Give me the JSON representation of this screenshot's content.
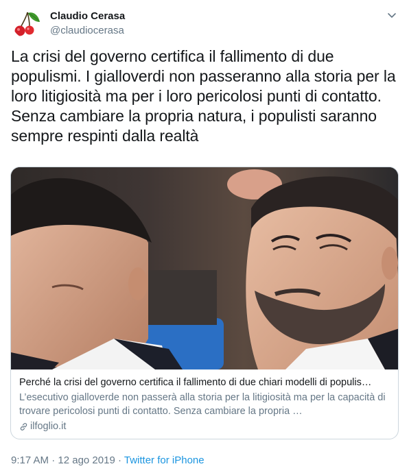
{
  "author": {
    "display_name": "Claudio Cerasa",
    "handle": "@claudiocerasa",
    "avatar_icon": "cherry-icon"
  },
  "tweet": {
    "text": "La crisi del governo certifica il fallimento di due populismi. I gialloverdi non passeranno alla storia per la loro litigiosità ma per i loro pericolosi punti di contatto. Senza cambiare la propria natura, i populisti saranno sempre respinti dalla realtà"
  },
  "card": {
    "title": "Perché la crisi del governo certifica il fallimento di due chiari modelli di populis…",
    "description": "L’esecutivo gialloverde non passerà alla storia per la litigiosità ma per la capacità di trovare pericolosi punti di contatto. Senza cambiare la propria …",
    "domain": "ilfoglio.it"
  },
  "meta": {
    "time": "9:17 AM",
    "separator1": " · ",
    "date": "12 ago 2019",
    "separator2": " · ",
    "source": "Twitter for iPhone"
  },
  "colors": {
    "text": "#14171a",
    "secondary": "#657786",
    "link": "#1b95e0",
    "border": "#ccd6dd"
  }
}
